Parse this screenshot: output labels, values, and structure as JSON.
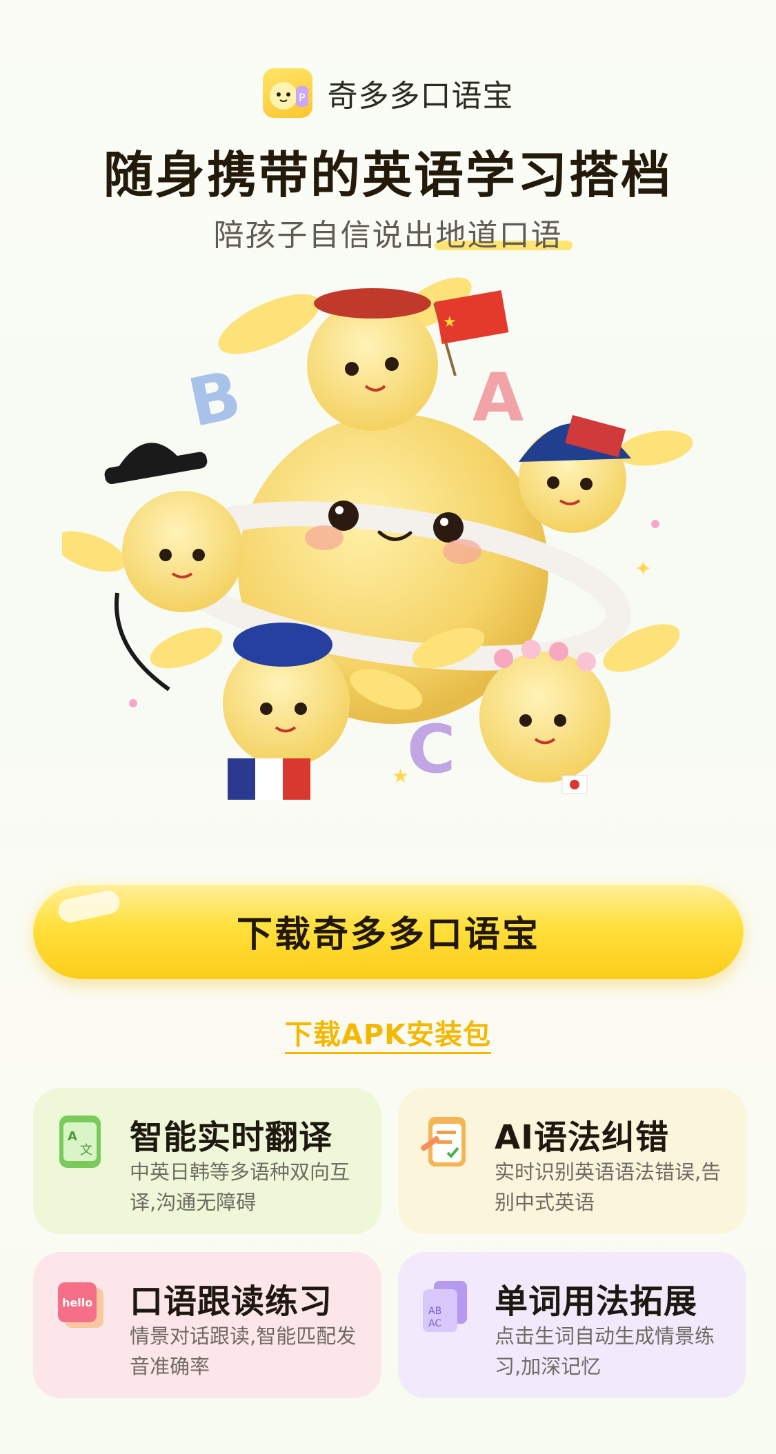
{
  "header": {
    "app_name": "奇多多口语宝",
    "headline": "随身携带的英语学习搭档",
    "subtitle": "陪孩子自信说出地道口语"
  },
  "hero": {
    "letters": [
      "B",
      "A",
      "C"
    ]
  },
  "actions": {
    "download_label": "下载奇多多口语宝",
    "apk_link_label": "下载APK安装包"
  },
  "features": [
    {
      "title": "智能实时翻译",
      "desc": "中英日韩等多语种双向互译,沟通无障碍",
      "icon": "translate-phone-icon",
      "bg": "#eef8d8"
    },
    {
      "title": "AI语法纠错",
      "desc": "实时识别英语语法错误,告别中式英语",
      "icon": "grammar-checklist-icon",
      "bg": "#fbf5dc"
    },
    {
      "title": "口语跟读练习",
      "desc": "情景对话跟读,智能匹配发音准确率",
      "icon": "hello-speech-icon",
      "bg": "#fde6ea"
    },
    {
      "title": "单词用法拓展",
      "desc": "点击生词自动生成情景练习,加深记忆",
      "icon": "word-cards-icon",
      "bg": "#f2e9fd"
    }
  ],
  "colors": {
    "accent": "#ffe03d",
    "link": "#f5b800",
    "text_dark": "#231a0a"
  }
}
